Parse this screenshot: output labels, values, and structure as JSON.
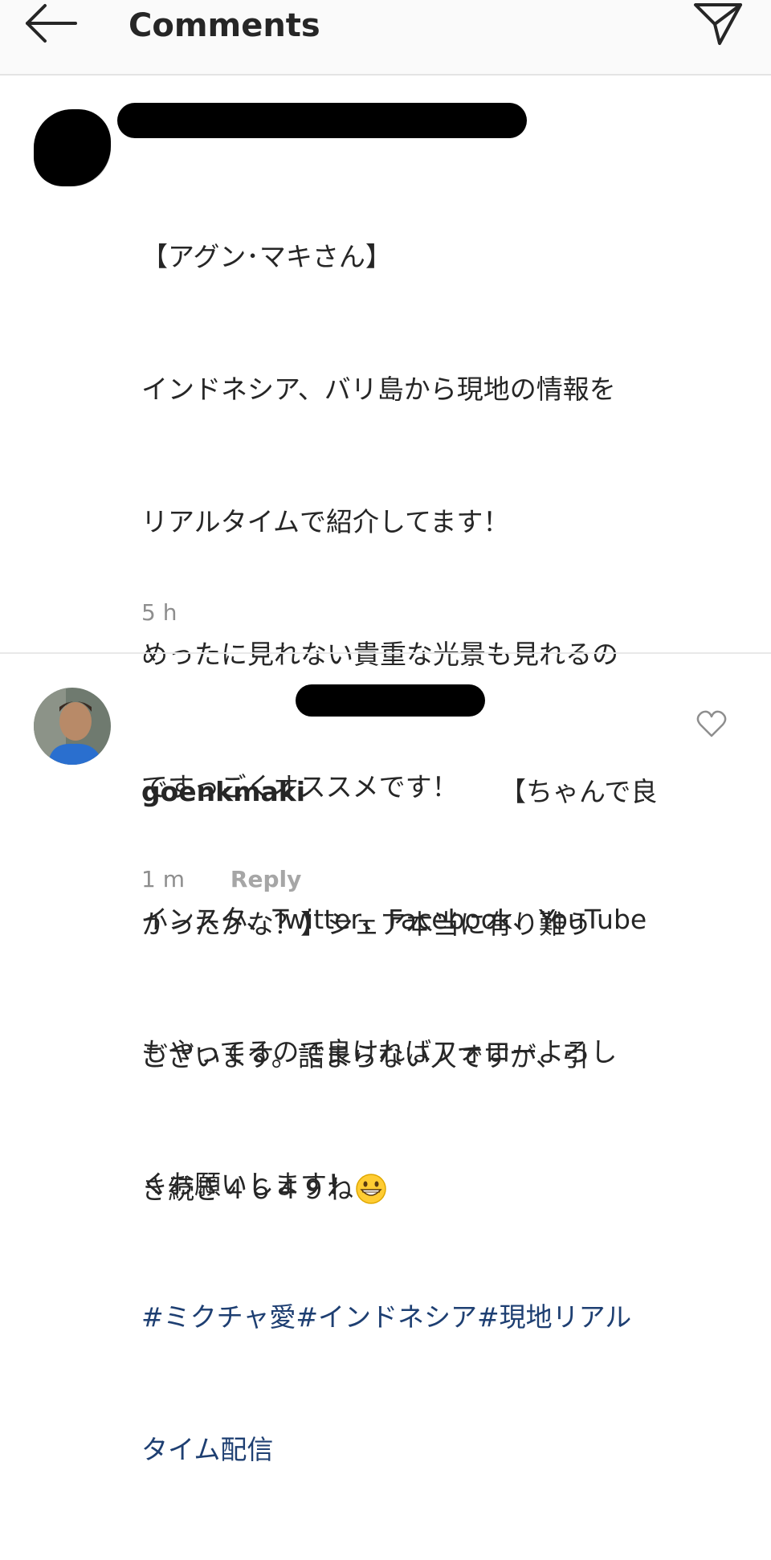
{
  "header": {
    "title": "Comments",
    "back_icon": "arrow-left-icon",
    "send_icon": "paper-plane-icon"
  },
  "post": {
    "lines": [
      "【アグン･マキさん】",
      "インドネシア、バリ島から現地の情報を",
      "リアルタイムで紹介してます！",
      "めったに見れない貴重な光景も見れるの",
      "ですっごくオススメです！",
      "インスタ、Twitter、Facebook、YouTube",
      "もやってるので良ければフォローよろし",
      "くお願いします！"
    ],
    "hashtags_line1": "#ミクチャ愛#インドネシア#現地リアル",
    "hashtags_line2": "タイム配信",
    "time": "5 h"
  },
  "reply": {
    "username": "goenkmaki",
    "line1_end": "【ちゃんで良",
    "lines": [
      "かったかな？】シェア本当に有り難う",
      "ございます。詰まらない人ですが、引",
      "き続き４６４９ね"
    ],
    "emoji": "grinning-face-icon",
    "time": "1 m",
    "reply_label": "Reply",
    "like_icon": "heart-outline-icon"
  },
  "colors": {
    "hashtag": "#1e3f72",
    "meta_gray": "#8e8e8e",
    "text": "#262626"
  }
}
